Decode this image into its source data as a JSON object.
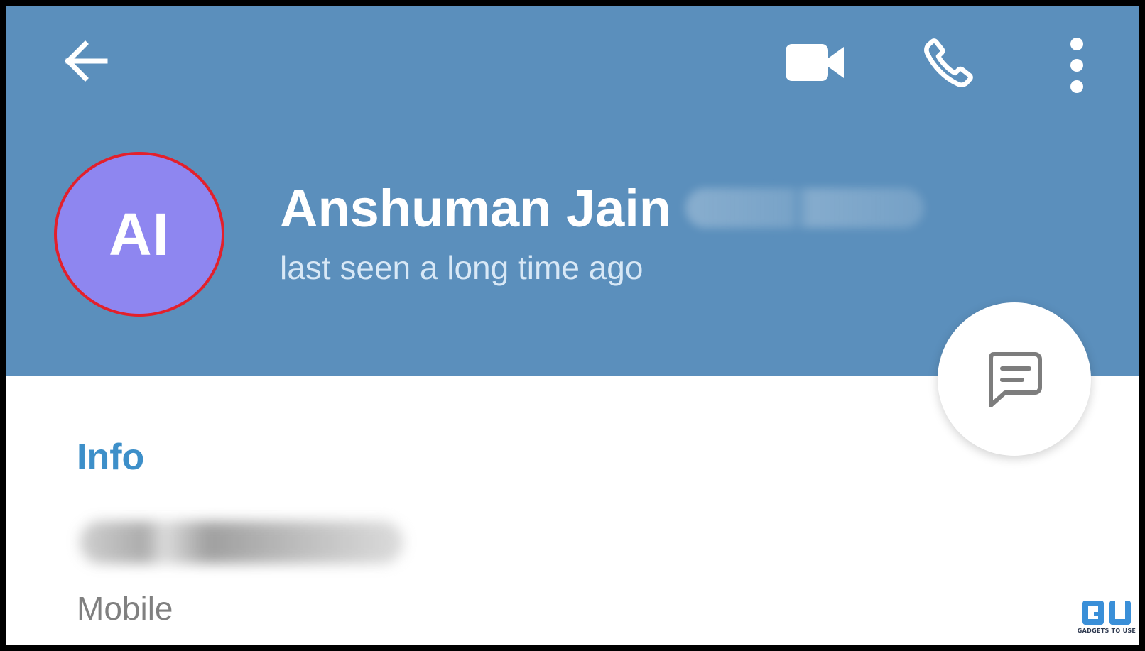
{
  "header": {
    "background_color": "#5b8fbc",
    "icons": {
      "back": "arrow-left-icon",
      "video": "video-camera-icon",
      "phone": "phone-icon",
      "more": "more-vertical-icon"
    }
  },
  "profile": {
    "initials": "AI",
    "avatar_color": "#8e86f0",
    "highlight_color": "#e3202b",
    "name": "Anshuman Jain",
    "status": "last seen a long time ago"
  },
  "fab": {
    "icon": "message-icon"
  },
  "info": {
    "section_title": "Info",
    "section_title_color": "#3d8fc9",
    "phone_label": "Mobile"
  },
  "watermark": {
    "caption": "GADGETS TO USE"
  }
}
